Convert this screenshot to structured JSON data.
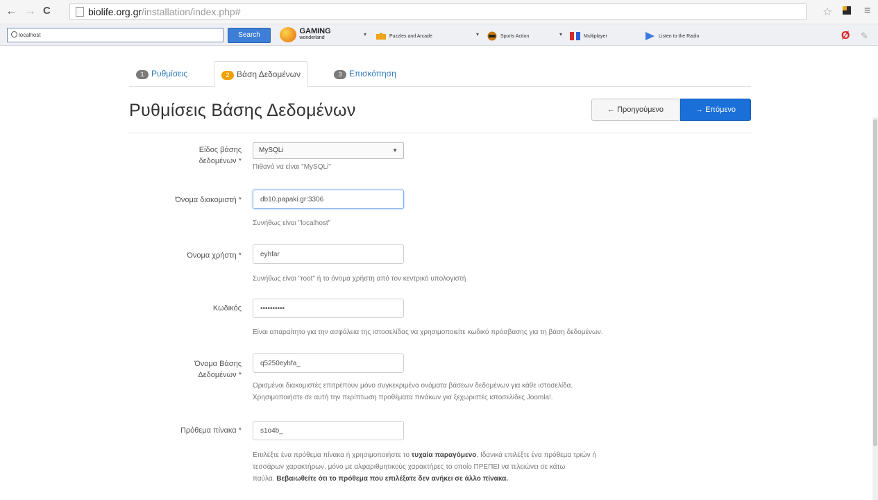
{
  "browser": {
    "url_host": "biolife.org.gr",
    "url_path": "/installation/index.php#",
    "nav_back": "←",
    "nav_forward": "→",
    "nav_reload": "C"
  },
  "toolbar": {
    "search_value": "localhost",
    "search_button": "Search",
    "logo_line1": "GAMING",
    "logo_line2": "wonderland",
    "items": [
      "Puzzles and Arcade",
      "Sports Action",
      "Multiplayer",
      "Listen to the Radio"
    ]
  },
  "steps": [
    {
      "num": "1",
      "label": "Ρυθμίσεις"
    },
    {
      "num": "2",
      "label": "Βάση Δεδομένων"
    },
    {
      "num": "3",
      "label": "Επισκόπηση"
    }
  ],
  "page_title": "Ρυθμίσεις Βάσης Δεδομένων",
  "buttons": {
    "previous": "Προηγούμενο",
    "next": "Επόμενο"
  },
  "form": {
    "db_type": {
      "label1": "Είδος βάσης",
      "label2": "δεδομένων *",
      "value": "MySQLi",
      "help": "Πιθανό να είναι \"MySQLi\""
    },
    "server": {
      "label": "Όνομα διακομιστή *",
      "value": "db10.papaki.gr:3306",
      "help": "Συνήθως είναι \"localhost\""
    },
    "username": {
      "label": "Όνομα χρήστη *",
      "value": "eyhfar",
      "help": "Συνήθως είναι \"root\" ή το όνομα χρήστη από τον κεντρικό υπολογιστή"
    },
    "password": {
      "label": "Κωδικός",
      "value": "••••••••••",
      "help": "Είναι απαραίτητο για την ασφάλεια της ιστοσελίδας να χρησιμοποιείτε κωδικό πρόσβασης για τη βάση δεδομένων."
    },
    "db_name": {
      "label1": "Όνομα Βάσης",
      "label2": "Δεδομένων *",
      "value": "q5250eyhfa_",
      "help1": "Ορισμένοι διακομιστές επιτρέπουν μόνο συγκεκριμένα ονόματα βάσεων δεδομένων για κάθε ιστοσελίδα.",
      "help2": "Χρησιμοποιήστε σε αυτή την περίπτωση προθέματα πινάκων για ξεχωριστές ιστοσελίδες Joomla!."
    },
    "prefix": {
      "label": "Πρόθεμα πίνακα *",
      "value": "s1o4b_",
      "help1a": "Επιλέξτε ένα πρόθεμα πίνακα ή χρησιμοποιήστε το ",
      "help1b": "τυχαία παραγόμενο",
      "help1c": ". Ιδανικά επιλέξτε ένα πρόθεμα τριών ή",
      "help2": "τεσσάρων χαρακτήρων, μόνο με αλφαριθμητικούς χαρακτήρες το οποίο ΠΡΕΠΕΙ να τελειώνει σε κάτω",
      "help3a": "παύλα. ",
      "help3b": "Βεβαιωθείτε ότι το πρόθεμα που επιλέξατε δεν ανήκει σε άλλο πίνακα."
    }
  }
}
